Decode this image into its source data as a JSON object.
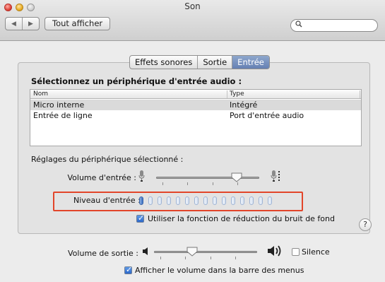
{
  "window": {
    "title": "Son"
  },
  "toolbar": {
    "back_label": "◀",
    "forward_label": "▶",
    "show_all_label": "Tout afficher",
    "search_placeholder": ""
  },
  "tabs": [
    {
      "label": "Effets sonores",
      "active": false
    },
    {
      "label": "Sortie",
      "active": false
    },
    {
      "label": "Entrée",
      "active": true
    }
  ],
  "input": {
    "section_title": "Sélectionnez un périphérique d'entrée audio :",
    "columns": [
      "Nom",
      "Type"
    ],
    "devices": [
      {
        "name": "Micro interne",
        "type": "Intégré",
        "selected": true
      },
      {
        "name": "Entrée de ligne",
        "type": "Port d'entrée audio",
        "selected": false
      }
    ],
    "settings_title": "Réglages du périphérique sélectionné :",
    "volume_label": "Volume d'entrée :",
    "volume_level": 0.78,
    "level_label": "Niveau d'entrée :",
    "level_active_count": 1,
    "level_total": 15,
    "noise_reduction_label": "Utiliser la fonction de réduction du bruit de fond",
    "noise_reduction_checked": true
  },
  "output": {
    "volume_label": "Volume de sortie :",
    "volume_level": 0.37,
    "mute_label": "Silence",
    "mute_checked": false,
    "show_in_menubar_label": "Afficher le volume dans la barre des menus",
    "show_in_menubar_checked": true
  },
  "help_label": "?",
  "colors": {
    "accent": "#3a6fc3",
    "highlight_box": "#e2452a",
    "selected_tab": "#6f8bbd"
  }
}
